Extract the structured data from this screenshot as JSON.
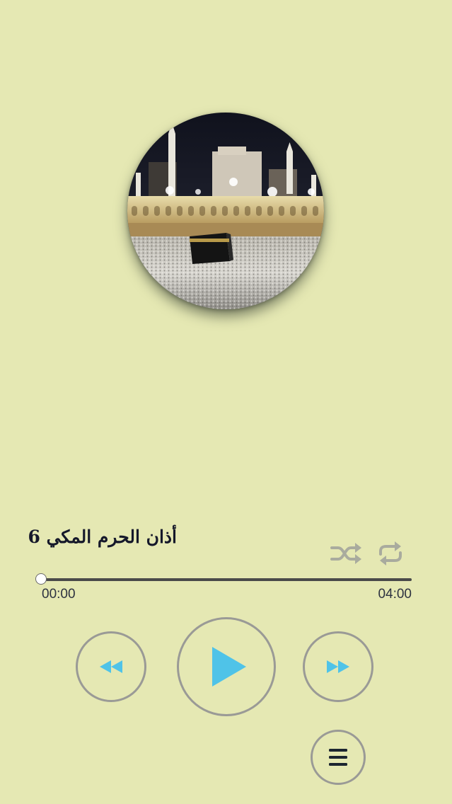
{
  "player": {
    "track_title": "أذان الحرم المكي 6",
    "elapsed_time": "00:00",
    "total_time": "04:00",
    "progress": 0
  },
  "controls": {
    "shuffle_icon": "shuffle-icon",
    "repeat_icon": "repeat-icon",
    "rewind_icon": "rewind-icon",
    "play_icon": "play-icon",
    "forward_icon": "fast-forward-icon",
    "menu_icon": "menu-icon"
  },
  "colors": {
    "background": "#e5e8b3",
    "accent": "#4fc3e8",
    "inactive": "#a9ab9e",
    "title": "#15182a"
  }
}
